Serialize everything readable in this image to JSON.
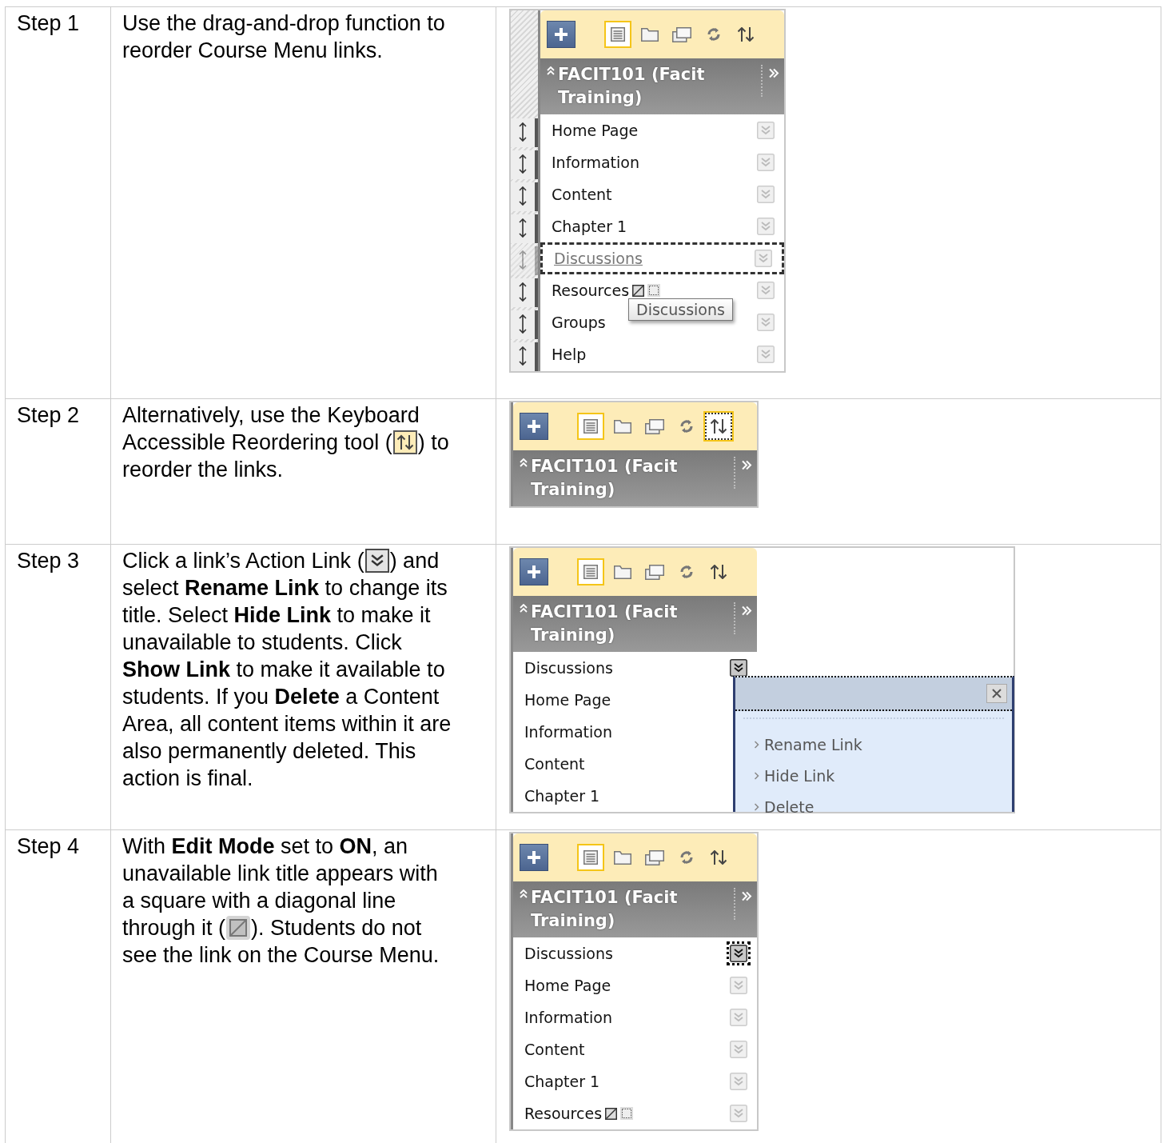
{
  "steps": [
    {
      "label": "Step 1",
      "lines": [
        [
          {
            "kind": "text",
            "text": "Use the drag-and-drop function to"
          }
        ],
        [
          {
            "kind": "text",
            "text": "reorder Course Menu links."
          }
        ]
      ],
      "menu": {
        "drag_handles": true,
        "toolbar": {
          "list_selected": true,
          "reorder_focused": false
        },
        "title": "FACIT101 (Facit Training)",
        "tooltip": "Discussions",
        "items": [
          {
            "label": "Home Page",
            "kind": "link",
            "action_shown": true,
            "action_active": false,
            "action_focused": false,
            "unavailable": false
          },
          {
            "label": "Information",
            "kind": "link",
            "action_shown": true,
            "action_active": false,
            "action_focused": false,
            "unavailable": false
          },
          {
            "label": "Content",
            "kind": "link",
            "action_shown": true,
            "action_active": false,
            "action_focused": false,
            "unavailable": false
          },
          {
            "label": "Chapter 1",
            "kind": "link",
            "action_shown": true,
            "action_active": false,
            "action_focused": false,
            "unavailable": false
          },
          {
            "label": "Discussions",
            "kind": "dragged",
            "action_shown": true,
            "action_active": false,
            "action_focused": false,
            "unavailable": false
          },
          {
            "label": "Resources",
            "kind": "link",
            "action_shown": true,
            "action_active": false,
            "action_focused": false,
            "unavailable": true
          },
          {
            "label": "Groups",
            "kind": "link",
            "action_shown": true,
            "action_active": false,
            "action_focused": false,
            "unavailable": false
          },
          {
            "label": "Help",
            "kind": "link",
            "action_shown": true,
            "action_active": false,
            "action_focused": false,
            "unavailable": false
          }
        ]
      }
    },
    {
      "label": "Step 2",
      "lines": [
        [
          {
            "kind": "text",
            "text": "Alternatively, use the Keyboard"
          }
        ],
        [
          {
            "kind": "text",
            "text": "Accessible Reordering tool ("
          },
          {
            "kind": "reorder"
          },
          {
            "kind": "text",
            "text": ") to"
          }
        ],
        [
          {
            "kind": "text",
            "text": "reorder the links."
          }
        ]
      ],
      "menu": {
        "drag_handles": false,
        "toolbar": {
          "list_selected": true,
          "reorder_focused": true
        },
        "title": "FACIT101 (Facit Training)"
      }
    },
    {
      "label": "Step 3",
      "lines": [
        [
          {
            "kind": "text",
            "text": "Click a link’s Action Link ("
          },
          {
            "kind": "action"
          },
          {
            "kind": "text",
            "text": ") and"
          }
        ],
        [
          {
            "kind": "text",
            "text": "select **Rename Link** to change its"
          }
        ],
        [
          {
            "kind": "text",
            "text": "title. Select **Hide Link** to make it"
          }
        ],
        [
          {
            "kind": "text",
            "text": "unavailable to students. Click"
          }
        ],
        [
          {
            "kind": "text",
            "text": "**Show Link** to make it available to"
          }
        ],
        [
          {
            "kind": "text",
            "text": "students. If you **Delete** a Content"
          }
        ],
        [
          {
            "kind": "text",
            "text": "Area, all content items within it are"
          }
        ],
        [
          {
            "kind": "text",
            "text": "also permanently deleted. This"
          }
        ],
        [
          {
            "kind": "text",
            "text": "action is final."
          }
        ]
      ],
      "menu": {
        "drag_handles": false,
        "toolbar": {
          "list_selected": true,
          "reorder_focused": false
        },
        "title": "FACIT101 (Facit Training)",
        "items": [
          {
            "label": "Discussions",
            "kind": "link",
            "action_shown": true,
            "action_active": true,
            "action_focused": false,
            "unavailable": false
          },
          {
            "label": "Home Page",
            "kind": "link",
            "action_shown": false,
            "unavailable": false
          },
          {
            "label": "Information",
            "kind": "link",
            "action_shown": false,
            "unavailable": false
          },
          {
            "label": "Content",
            "kind": "link",
            "action_shown": false,
            "unavailable": false
          },
          {
            "label": "Chapter 1",
            "kind": "link",
            "action_shown": false,
            "unavailable": false
          }
        ],
        "popup": {
          "items": [
            "Rename Link",
            "Hide Link",
            "Delete"
          ]
        }
      }
    },
    {
      "label": "Step 4",
      "lines": [
        [
          {
            "kind": "text",
            "text": "With **Edit Mode** set to **ON**, an"
          }
        ],
        [
          {
            "kind": "text",
            "text": "unavailable link title appears with"
          }
        ],
        [
          {
            "kind": "text",
            "text": "a square with a diagonal line"
          }
        ],
        [
          {
            "kind": "text",
            "text": "through it ("
          },
          {
            "kind": "hidden"
          },
          {
            "kind": "text",
            "text": "). Students do not"
          }
        ],
        [
          {
            "kind": "text",
            "text": "see the link on the Course Menu."
          }
        ]
      ],
      "menu": {
        "drag_handles": false,
        "toolbar": {
          "list_selected": true,
          "reorder_focused": false
        },
        "title": "FACIT101 (Facit Training)",
        "items": [
          {
            "label": "Discussions",
            "kind": "link",
            "action_shown": true,
            "action_active": true,
            "action_focused": true,
            "unavailable": false
          },
          {
            "label": "Home Page",
            "kind": "link",
            "action_shown": true,
            "action_active": false,
            "action_focused": false,
            "unavailable": false
          },
          {
            "label": "Information",
            "kind": "link",
            "action_shown": true,
            "action_active": false,
            "action_focused": false,
            "unavailable": false
          },
          {
            "label": "Content",
            "kind": "link",
            "action_shown": true,
            "action_active": false,
            "action_focused": false,
            "unavailable": false
          },
          {
            "label": "Chapter 1",
            "kind": "link",
            "action_shown": true,
            "action_active": false,
            "action_focused": false,
            "unavailable": false
          },
          {
            "label": "Resources",
            "kind": "link",
            "action_shown": true,
            "action_active": false,
            "action_focused": false,
            "unavailable": true
          }
        ]
      }
    }
  ]
}
